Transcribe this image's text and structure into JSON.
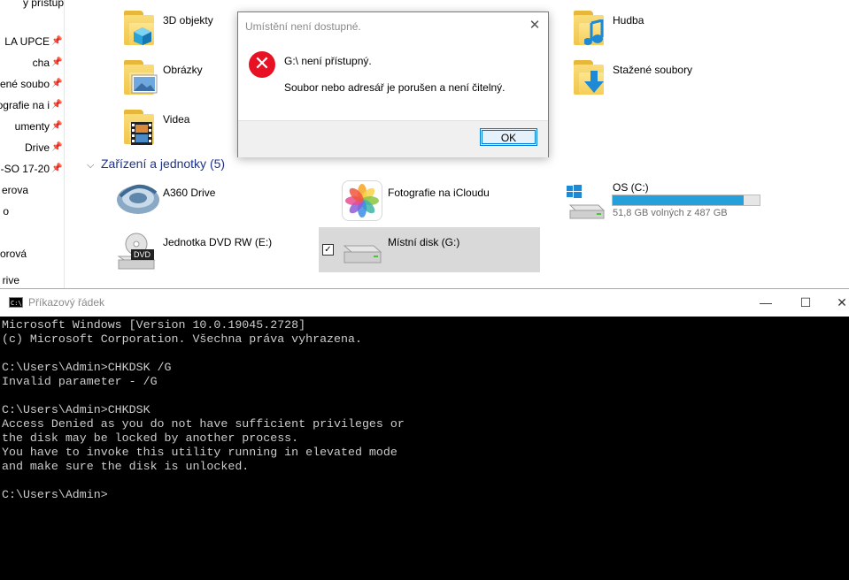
{
  "explorer": {
    "nav_items": [
      {
        "label": "y přístup",
        "pinned": false
      },
      {
        "label": "LA UPCE",
        "pinned": true
      },
      {
        "label": "cha",
        "pinned": true
      },
      {
        "label": "ené soubo",
        "pinned": true
      },
      {
        "label": "ografie na i",
        "pinned": true
      },
      {
        "label": "umenty",
        "pinned": true
      },
      {
        "label": "Drive",
        "pinned": true
      },
      {
        "label": "-SO 17-20",
        "pinned": true
      },
      {
        "label": "erova",
        "pinned": false
      },
      {
        "label": "o",
        "pinned": false
      },
      {
        "label": "orová",
        "pinned": false
      },
      {
        "label": "rive",
        "pinned": false
      }
    ],
    "folders": [
      {
        "label": "3D objekty",
        "icon": "3d-objects-folder-icon"
      },
      {
        "label": "Obrázky",
        "icon": "pictures-folder-icon"
      },
      {
        "label": "Videa",
        "icon": "videos-folder-icon"
      },
      {
        "label": "Hudba",
        "icon": "music-folder-icon"
      },
      {
        "label": "Stažené soubory",
        "icon": "downloads-folder-icon"
      }
    ],
    "devices_section": "Zařízení a jednotky (5)",
    "devices": [
      {
        "label": "A360 Drive",
        "icon": "a360-drive-icon"
      },
      {
        "label": "Fotografie na iCloudu",
        "icon": "icloud-photos-icon"
      },
      {
        "label": "OS (C:)",
        "icon": "windows-drive-icon",
        "free": "51,8 GB volných z 487 GB",
        "used_fraction": 0.894
      },
      {
        "label": "Jednotka DVD RW (E:)",
        "icon": "dvd-drive-icon",
        "badge": "DVD"
      },
      {
        "label": "Místní disk (G:)",
        "icon": "local-disk-icon",
        "selected": true
      }
    ]
  },
  "dialog": {
    "title": "Umístění není dostupné.",
    "message1": "G:\\ není přístupný.",
    "message2": "Soubor nebo adresář je porušen a není čitelný.",
    "ok_label": "OK",
    "close_glyph": "✕",
    "error_glyph": "✕",
    "error_color": "#e81123"
  },
  "cmd": {
    "title": "Příkazový řádek",
    "minimize": "—",
    "maximize": "☐",
    "close": "✕",
    "lines": [
      "Microsoft Windows [Version 10.0.19045.2728]",
      "(c) Microsoft Corporation. Všechna práva vyhrazena.",
      "",
      "C:\\Users\\Admin>CHKDSK /G",
      "Invalid parameter - /G",
      "",
      "C:\\Users\\Admin>CHKDSK",
      "Access Denied as you do not have sufficient privileges or",
      "the disk may be locked by another process.",
      "You have to invoke this utility running in elevated mode",
      "and make sure the disk is unlocked.",
      "",
      "C:\\Users\\Admin>"
    ]
  }
}
